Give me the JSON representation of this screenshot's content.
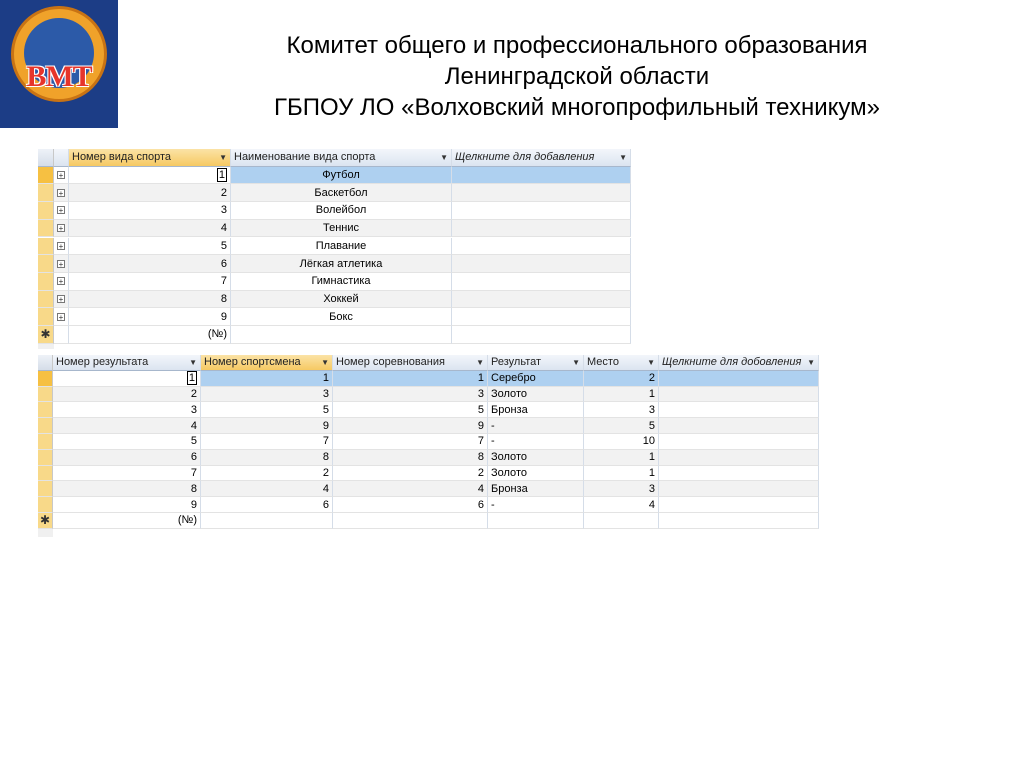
{
  "logo": {
    "text": "ВМТ"
  },
  "title": {
    "line1": "Комитет общего и профессионального образования",
    "line2": "Ленинградской области",
    "line3": "ГБПОУ ЛО  «Волховский многопрофильный техникум»"
  },
  "sports_table": {
    "columns": [
      "Номер вида спорта",
      "Наименование вида спорта",
      "Щелкните для добавления"
    ],
    "rows": [
      {
        "id": "1",
        "name": "Футбол"
      },
      {
        "id": "2",
        "name": "Баскетбол"
      },
      {
        "id": "3",
        "name": "Волейбол"
      },
      {
        "id": "4",
        "name": "Теннис"
      },
      {
        "id": "5",
        "name": "Плавание"
      },
      {
        "id": "6",
        "name": "Лёгкая атлетика"
      },
      {
        "id": "7",
        "name": "Гимнастика"
      },
      {
        "id": "8",
        "name": "Хоккей"
      },
      {
        "id": "9",
        "name": "Бокс"
      }
    ],
    "new_row_label": "(№)"
  },
  "results_table": {
    "columns": [
      "Номер результата",
      "Номер спортсмена",
      "Номер соревнования",
      "Результат",
      "Место",
      "Щелкните для добовления"
    ],
    "rows": [
      {
        "id": "1",
        "athlete": "1",
        "competition": "1",
        "result": "Серебро",
        "place": "2"
      },
      {
        "id": "2",
        "athlete": "3",
        "competition": "3",
        "result": "Золото",
        "place": "1"
      },
      {
        "id": "3",
        "athlete": "5",
        "competition": "5",
        "result": "Бронза",
        "place": "3"
      },
      {
        "id": "4",
        "athlete": "9",
        "competition": "9",
        "result": "-",
        "place": "5"
      },
      {
        "id": "5",
        "athlete": "7",
        "competition": "7",
        "result": "-",
        "place": "10"
      },
      {
        "id": "6",
        "athlete": "8",
        "competition": "8",
        "result": "Золото",
        "place": "1"
      },
      {
        "id": "7",
        "athlete": "2",
        "competition": "2",
        "result": "Золото",
        "place": "1"
      },
      {
        "id": "8",
        "athlete": "4",
        "competition": "4",
        "result": "Бронза",
        "place": "3"
      },
      {
        "id": "9",
        "athlete": "6",
        "competition": "6",
        "result": "-",
        "place": "4"
      }
    ],
    "new_row_label": "(№)"
  },
  "icons": {
    "expand": "plus-box-icon",
    "new_record": "asterisk-icon",
    "dropdown": "dropdown-arrow-icon"
  }
}
